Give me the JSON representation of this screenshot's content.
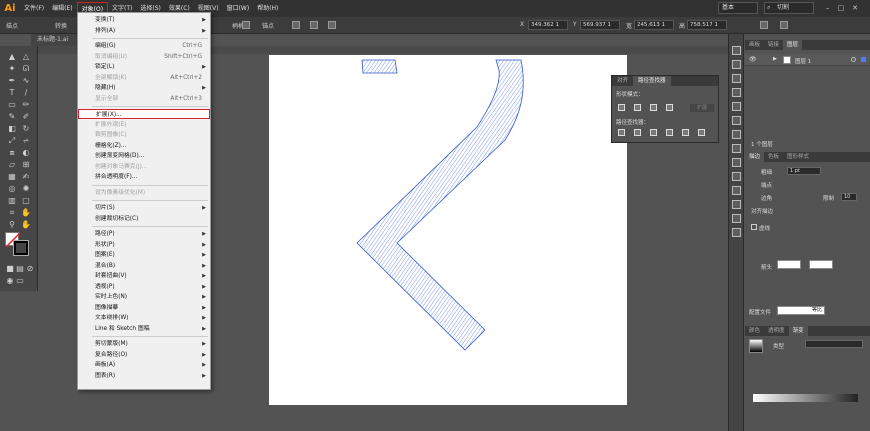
{
  "menubar": {
    "logo": "Ai",
    "items": [
      "文件(F)",
      "编辑(E)",
      "对象(O)",
      "文字(T)",
      "选择(S)",
      "效果(C)",
      "视图(V)",
      "窗口(W)",
      "帮助(H)"
    ],
    "workspace": "基本",
    "search": "切割"
  },
  "controlbar": {
    "left_label": "描点",
    "convert_label": "转换",
    "handle_label": "柄柄",
    "anchor_label": "锚点",
    "x_label": "X",
    "x_value": "349.362 1",
    "y_label": "Y",
    "y_value": "569.937 1",
    "w_label": "宽",
    "w_value": "245.613 1",
    "h_label": "高",
    "h_value": "758.517 1"
  },
  "document": {
    "tab_label": "未标题-1.ai"
  },
  "dropdown": {
    "items": [
      {
        "label": "变换(T)",
        "sc": "",
        "sub": true,
        "dis": false
      },
      {
        "label": "排列(A)",
        "sc": "",
        "sub": true,
        "dis": false
      },
      {
        "label": "编组(G)",
        "sc": "Ctrl+G",
        "sub": false,
        "dis": false
      },
      {
        "label": "取消编组(U)",
        "sc": "Shift+Ctrl+G",
        "sub": false,
        "dis": true
      },
      {
        "label": "锁定(L)",
        "sc": "",
        "sub": true,
        "dis": false
      },
      {
        "label": "全部解锁(K)",
        "sc": "Alt+Ctrl+2",
        "sub": false,
        "dis": true
      },
      {
        "label": "隐藏(H)",
        "sc": "",
        "sub": true,
        "dis": false
      },
      {
        "label": "显示全部",
        "sc": "Alt+Ctrl+3",
        "sub": false,
        "dis": true
      },
      {
        "label": "扩展(X)...",
        "sc": "",
        "sub": false,
        "dis": false
      },
      {
        "label": "扩展外观(E)",
        "sc": "",
        "sub": false,
        "dis": true
      },
      {
        "label": "裁剪图像(C)",
        "sc": "",
        "sub": false,
        "dis": true
      },
      {
        "label": "栅格化(Z)...",
        "sc": "",
        "sub": false,
        "dis": false
      },
      {
        "label": "创建渐变网格(D)...",
        "sc": "",
        "sub": false,
        "dis": false
      },
      {
        "label": "创建对象马赛克(J)...",
        "sc": "",
        "sub": false,
        "dis": true
      },
      {
        "label": "拼合透明度(F)...",
        "sc": "",
        "sub": false,
        "dis": false
      },
      {
        "label": "设为像素级优化(M)",
        "sc": "",
        "sub": false,
        "dis": true
      },
      {
        "label": "切片(S)",
        "sc": "",
        "sub": true,
        "dis": false
      },
      {
        "label": "创建裁切标记(C)",
        "sc": "",
        "sub": false,
        "dis": false
      },
      {
        "label": "路径(P)",
        "sc": "",
        "sub": true,
        "dis": false
      },
      {
        "label": "形状(P)",
        "sc": "",
        "sub": true,
        "dis": false
      },
      {
        "label": "图案(E)",
        "sc": "",
        "sub": true,
        "dis": false
      },
      {
        "label": "混合(B)",
        "sc": "",
        "sub": true,
        "dis": false
      },
      {
        "label": "封套扭曲(V)",
        "sc": "",
        "sub": true,
        "dis": false
      },
      {
        "label": "透视(P)",
        "sc": "",
        "sub": true,
        "dis": false
      },
      {
        "label": "实时上色(N)",
        "sc": "",
        "sub": true,
        "dis": false
      },
      {
        "label": "图像描摹",
        "sc": "",
        "sub": true,
        "dis": false
      },
      {
        "label": "文本绕排(W)",
        "sc": "",
        "sub": true,
        "dis": false
      },
      {
        "label": "Line 和 Sketch 图稿",
        "sc": "",
        "sub": true,
        "dis": false
      },
      {
        "label": "剪切蒙版(M)",
        "sc": "",
        "sub": true,
        "dis": false
      },
      {
        "label": "复合路径(O)",
        "sc": "",
        "sub": true,
        "dis": false
      },
      {
        "label": "画板(A)",
        "sc": "",
        "sub": true,
        "dis": false
      },
      {
        "label": "图表(R)",
        "sc": "",
        "sub": true,
        "dis": false
      }
    ]
  },
  "pathfinder": {
    "tab_transform": "对齐",
    "tab_pathfinder": "路径查找器",
    "shape_modes": "形状模式：",
    "pathfinders": "路径查找器：",
    "expand": "扩展"
  },
  "layers": {
    "tabs": [
      "画板",
      "链接",
      "图层"
    ],
    "layer_name": "图层 1",
    "count": "1 个图层"
  },
  "stroke": {
    "tabs": [
      "描边",
      "色板",
      "图形样式"
    ],
    "weight_label": "粗细",
    "weight_value": "1 pt",
    "cap_label": "端点",
    "corner_label": "边角",
    "limit_label": "限制",
    "limit_value": "10",
    "align_label": "对齐描边",
    "dashed_label": "虚线",
    "arrow_label": "箭头",
    "profile_label": "配置文件",
    "profile_value": "等比"
  },
  "gradient": {
    "tabs": [
      "颜色",
      "透明度",
      "渐变"
    ],
    "type_label": "类型"
  }
}
